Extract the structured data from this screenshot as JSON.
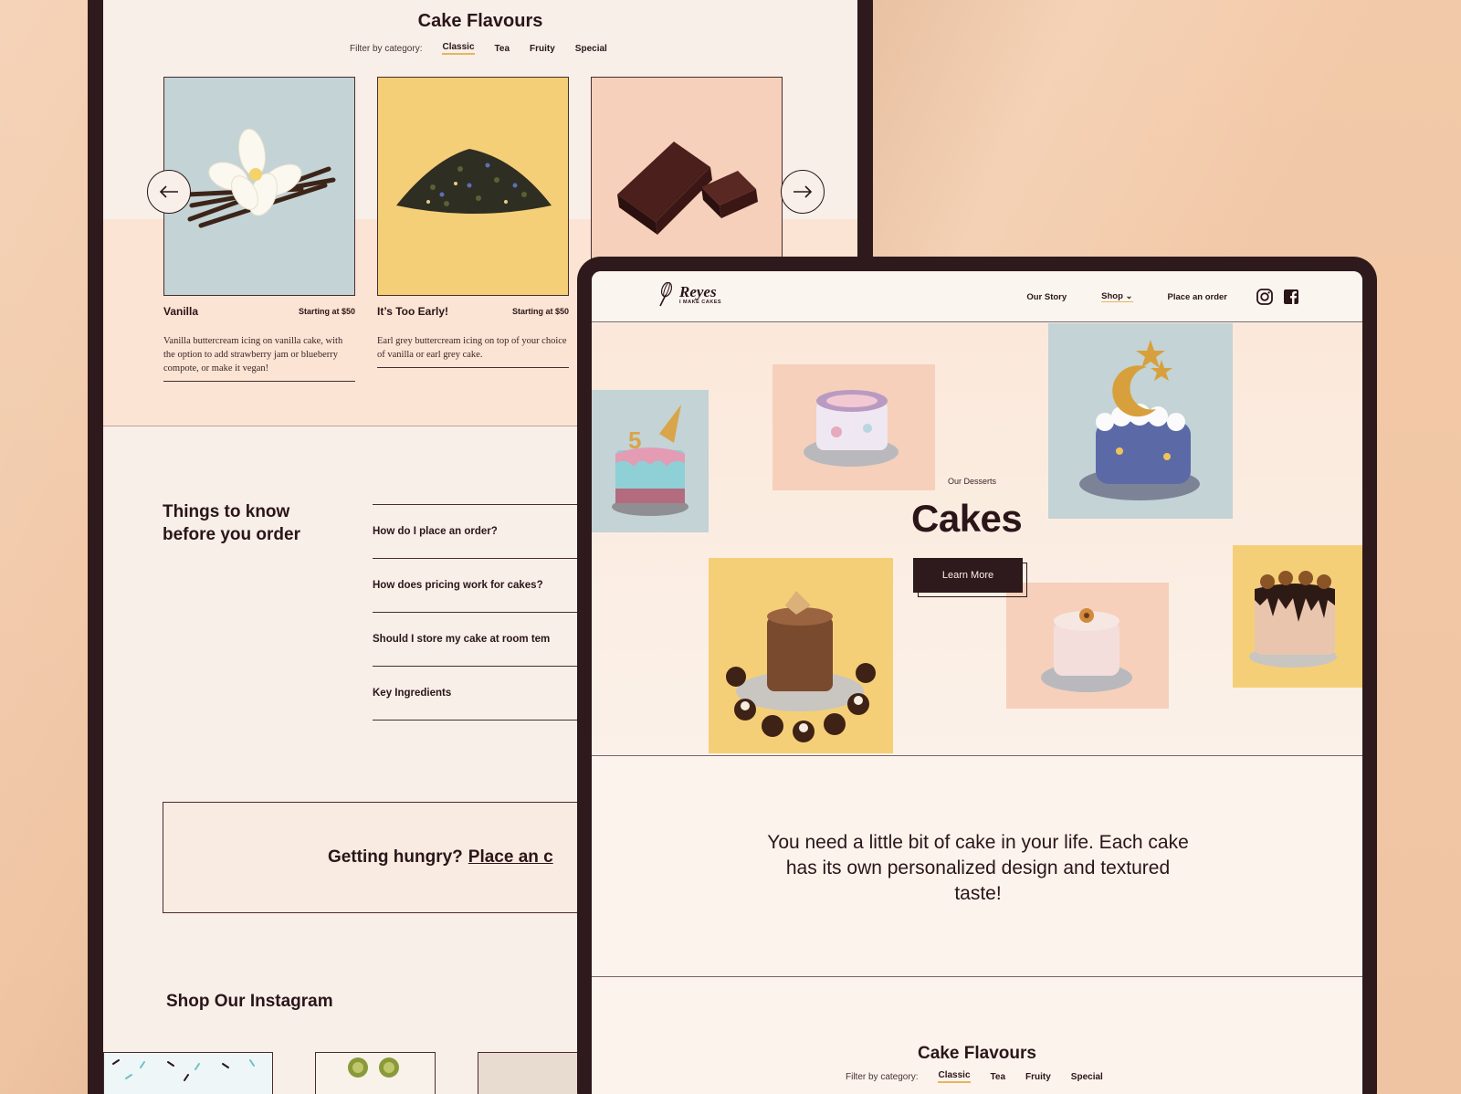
{
  "back_page": {
    "flavours_title": "Cake Flavours",
    "filter": {
      "label": "Filter by category:",
      "categories": [
        "Classic",
        "Tea",
        "Fruity",
        "Special"
      ],
      "active": "Classic"
    },
    "cards": [
      {
        "name": "Vanilla",
        "price": "Starting at $50",
        "description": "Vanilla buttercream icing on vanilla cake, with the option to add strawberry jam or blueberry compote, or make it vegan!"
      },
      {
        "name": "It’s Too Early!",
        "price": "Starting at $50",
        "description": "Earl grey buttercream icing on top of your choice of vanilla or earl grey cake."
      },
      {
        "name": "",
        "price": "",
        "description": ""
      }
    ],
    "things_title": "Things to know before you order",
    "faq": [
      "How do I place an order?",
      "How does pricing work for cakes?",
      "Should I store my cake at room tem",
      "Key Ingredients"
    ],
    "hungry_text": "Getting hungry?",
    "hungry_link": "Place an c",
    "instagram_title": "Shop Our Instagram"
  },
  "front_page": {
    "logo": {
      "word": "Reyes",
      "tagline": "I MAKE CAKES"
    },
    "nav": {
      "our_story": "Our Story",
      "shop": "Shop",
      "shop_caret": "⌄",
      "place_order": "Place an order"
    },
    "hero": {
      "kicker": "Our Desserts",
      "title": "Cakes",
      "cta": "Learn More"
    },
    "quote": "You need a little bit of cake in your life. Each cake has its own personalized design and textured taste!",
    "flavours_title": "Cake Flavours",
    "filter": {
      "label": "Filter by category:",
      "categories": [
        "Classic",
        "Tea",
        "Fruity",
        "Special"
      ],
      "active": "Classic"
    }
  },
  "colors": {
    "dark_brown": "#2e1a1c",
    "peach_background": "#f1c8a7",
    "accent_gold": "#e7b55b",
    "pale_blue": "#c3d3d6",
    "mustard": "#f5cf78",
    "blush": "#f6d0bb"
  },
  "icons": [
    "arrow-left-icon",
    "arrow-right-icon",
    "instagram-icon",
    "facebook-icon",
    "whisk-logo-icon"
  ]
}
